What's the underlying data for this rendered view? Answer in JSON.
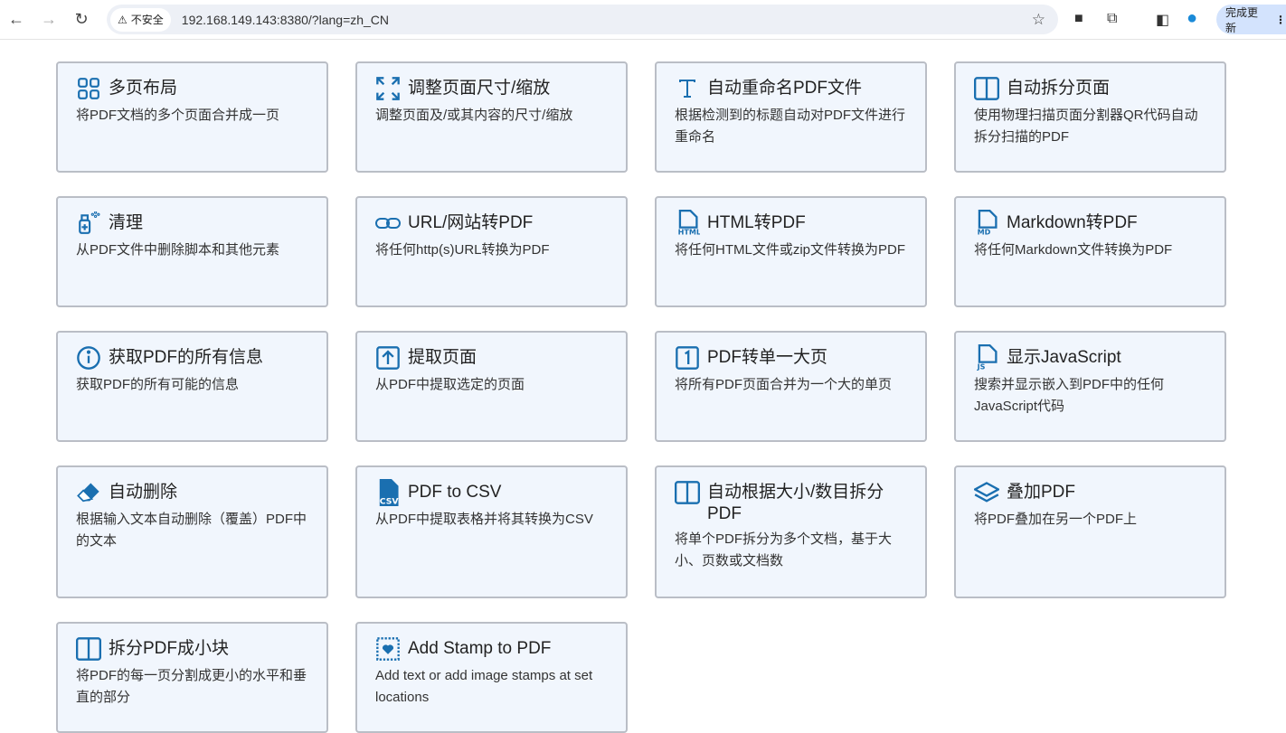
{
  "browser": {
    "back": "←",
    "forward": "→",
    "reload": "↻",
    "security": "不安全",
    "url": "192.168.149.143:8380/?lang=zh_CN",
    "update": "完成更新"
  },
  "colors": {
    "accent": "#1a6fb0",
    "card_bg": "#f1f6fd",
    "card_border": "#babec6"
  },
  "cards": [
    {
      "icon": "grid-icon",
      "title": "多页布局",
      "desc": "将PDF文档的多个页面合并成一页"
    },
    {
      "icon": "resize-icon",
      "title": "调整页面尺寸/缩放",
      "desc": "调整页面及/或其内容的尺寸/缩放"
    },
    {
      "icon": "text-icon",
      "title": "自动重命名PDF文件",
      "desc": "根据检测到的标题自动对PDF文件进行重命名"
    },
    {
      "icon": "split-page-icon",
      "title": "自动拆分页面",
      "desc": "使用物理扫描页面分割器QR代码自动拆分扫描的PDF"
    },
    {
      "icon": "spray-clean-icon",
      "title": "清理",
      "desc": "从PDF文件中删除脚本和其他元素"
    },
    {
      "icon": "link-icon",
      "title": "URL/网站转PDF",
      "desc": "将任何http(s)URL转换为PDF"
    },
    {
      "icon": "html-file-icon",
      "title": "HTML转PDF",
      "desc": "将任何HTML文件或zip文件转换为PDF"
    },
    {
      "icon": "markdown-file-icon",
      "title": "Markdown转PDF",
      "desc": "将任何Markdown文件转换为PDF"
    },
    {
      "icon": "info-icon",
      "title": "获取PDF的所有信息",
      "desc": "获取PDF的所有可能的信息"
    },
    {
      "icon": "extract-upload-icon",
      "title": "提取页面",
      "desc": "从PDF中提取选定的页面"
    },
    {
      "icon": "single-page-icon",
      "title": "PDF转单一大页",
      "desc": "将所有PDF页面合并为一个大的单页"
    },
    {
      "icon": "js-file-icon",
      "title": "显示JavaScript",
      "desc": "搜索并显示嵌入到PDF中的任何JavaScript代码"
    },
    {
      "icon": "eraser-icon",
      "title": "自动删除",
      "desc": "根据输入文本自动删除（覆盖）PDF中的文本"
    },
    {
      "icon": "csv-file-icon",
      "title": "PDF to CSV",
      "desc": "从PDF中提取表格并将其转换为CSV"
    },
    {
      "icon": "split-icon",
      "title": "自动根据大小/数目拆分PDF",
      "desc": "将单个PDF拆分为多个文档，基于大小、页数或文档数"
    },
    {
      "icon": "layers-icon",
      "title": "叠加PDF",
      "desc": "将PDF叠加在另一个PDF上"
    },
    {
      "icon": "split-chunks-icon",
      "title": "拆分PDF成小块",
      "desc": "将PDF的每一页分割成更小的水平和垂直的部分"
    },
    {
      "icon": "stamp-icon",
      "title": "Add Stamp to PDF",
      "desc": "Add text or add image stamps at set locations"
    }
  ]
}
